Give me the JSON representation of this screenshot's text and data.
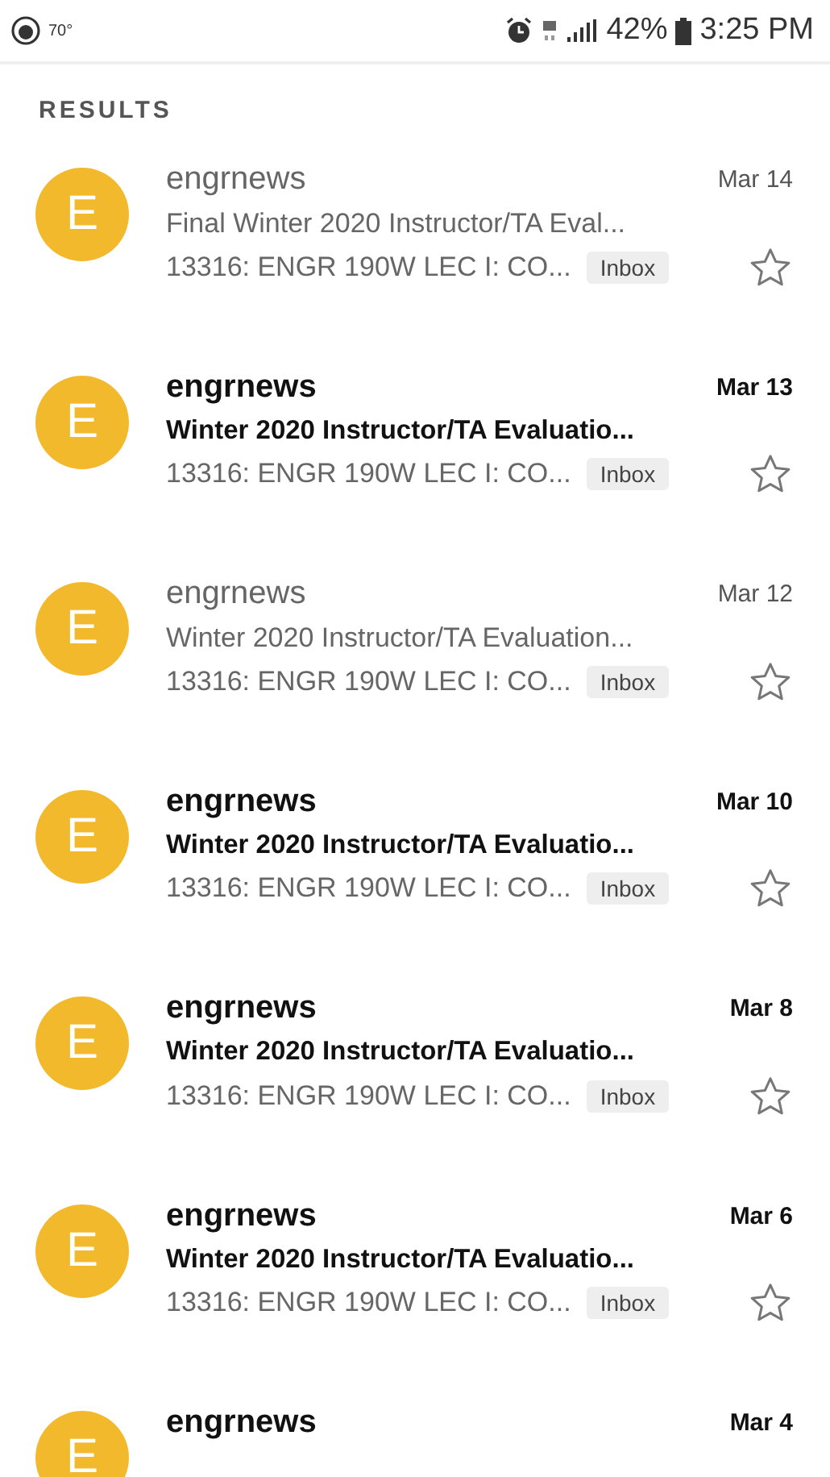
{
  "status_bar": {
    "temperature": "70°",
    "battery": "42%",
    "time": "3:25 PM"
  },
  "section_title": "RESULTS",
  "emails": [
    {
      "avatar": "E",
      "sender": "engrnews",
      "date": "Mar 14",
      "subject": "Final Winter 2020 Instructor/TA Eval...",
      "snippet": "13316: ENGR 190W LEC I: CO...",
      "label": "Inbox",
      "unread": false,
      "starred": false
    },
    {
      "avatar": "E",
      "sender": "engrnews",
      "date": "Mar 13",
      "subject": "Winter 2020 Instructor/TA Evaluatio...",
      "snippet": "13316: ENGR 190W LEC I: CO...",
      "label": "Inbox",
      "unread": true,
      "starred": false
    },
    {
      "avatar": "E",
      "sender": "engrnews",
      "date": "Mar 12",
      "subject": "Winter 2020 Instructor/TA Evaluation...",
      "snippet": "13316: ENGR 190W LEC I: CO...",
      "label": "Inbox",
      "unread": false,
      "starred": false
    },
    {
      "avatar": "E",
      "sender": "engrnews",
      "date": "Mar 10",
      "subject": "Winter 2020 Instructor/TA Evaluatio...",
      "snippet": "13316: ENGR 190W LEC I: CO...",
      "label": "Inbox",
      "unread": true,
      "starred": false
    },
    {
      "avatar": "E",
      "sender": "engrnews",
      "date": "Mar 8",
      "subject": "Winter 2020 Instructor/TA Evaluatio...",
      "snippet": "13316: ENGR 190W LEC I: CO...",
      "label": "Inbox",
      "unread": true,
      "starred": false
    },
    {
      "avatar": "E",
      "sender": "engrnews",
      "date": "Mar 6",
      "subject": "Winter 2020 Instructor/TA Evaluatio...",
      "snippet": "13316: ENGR 190W LEC I: CO...",
      "label": "Inbox",
      "unread": true,
      "starred": false
    },
    {
      "avatar": "E",
      "sender": "engrnews",
      "date": "Mar 4",
      "unread": true
    }
  ]
}
